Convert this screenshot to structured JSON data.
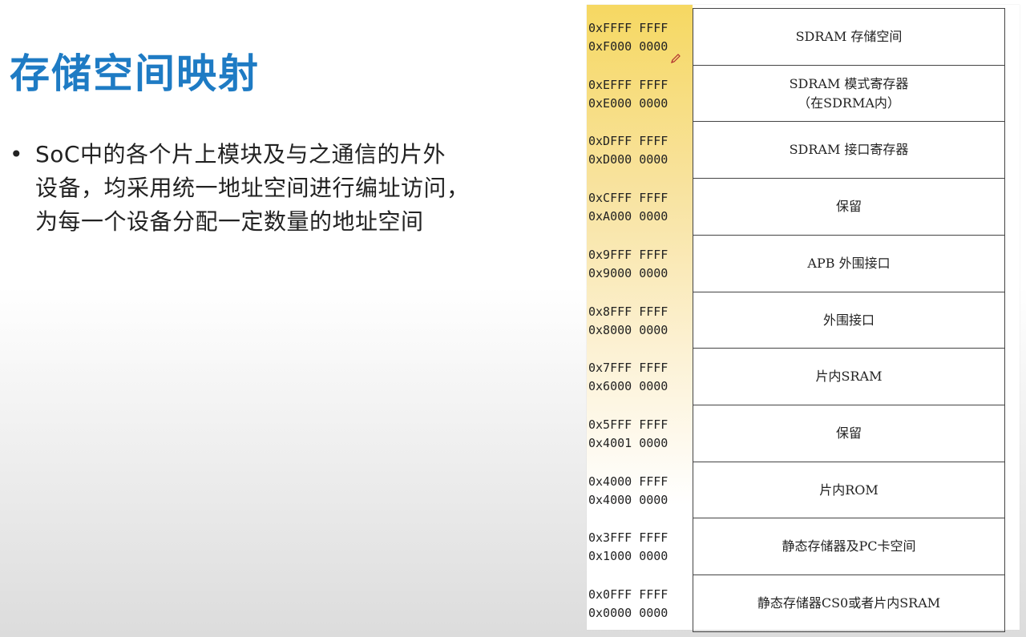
{
  "slide": {
    "title": "存储空间映射",
    "bullet_lines": [
      "SoC中的各个片上模块及与之通信的片外",
      "设备，均采用统一地址空间进行编址访问，",
      "为每一个设备分配一定数量的地址空间"
    ]
  },
  "memory_map": {
    "rows": [
      {
        "addr_high": "0xFFFF FFFF",
        "addr_low": "0xF000 0000",
        "region": "SDRAM 存储空间",
        "region_note": ""
      },
      {
        "addr_high": "0xEFFF FFFF",
        "addr_low": "0xE000 0000",
        "region": "SDRAM 模式寄存器",
        "region_note": "（在SDRMA内）"
      },
      {
        "addr_high": "0xDFFF FFFF",
        "addr_low": "0xD000 0000",
        "region": "SDRAM 接口寄存器",
        "region_note": ""
      },
      {
        "addr_high": "0xCFFF FFFF",
        "addr_low": "0xA000 0000",
        "region": "保留",
        "region_note": ""
      },
      {
        "addr_high": "0x9FFF FFFF",
        "addr_low": "0x9000 0000",
        "region": "APB 外围接口",
        "region_note": ""
      },
      {
        "addr_high": "0x8FFF FFFF",
        "addr_low": "0x8000 0000",
        "region": "外围接口",
        "region_note": ""
      },
      {
        "addr_high": "0x7FFF FFFF",
        "addr_low": "0x6000 0000",
        "region": "片内SRAM",
        "region_note": ""
      },
      {
        "addr_high": "0x5FFF FFFF",
        "addr_low": "0x4001 0000",
        "region": "保留",
        "region_note": ""
      },
      {
        "addr_high": "0x4000 FFFF",
        "addr_low": "0x4000 0000",
        "region": "片内ROM",
        "region_note": ""
      },
      {
        "addr_high": "0x3FFF FFFF",
        "addr_low": "0x1000 0000",
        "region": "静态存储器及PC卡空间",
        "region_note": ""
      },
      {
        "addr_high": "0x0FFF FFFF",
        "addr_low": "0x0000 0000",
        "region": "静态存储器CS0或者片内SRAM",
        "region_note": ""
      }
    ]
  }
}
